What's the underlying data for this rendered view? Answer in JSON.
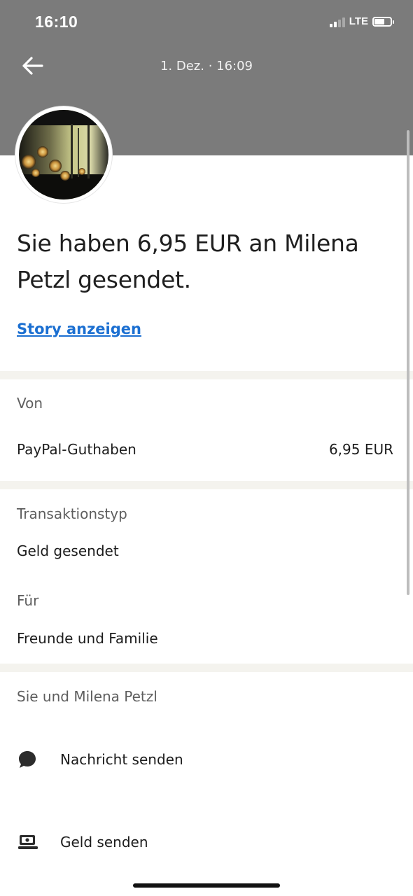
{
  "status_bar": {
    "time": "16:10",
    "network": "LTE"
  },
  "header": {
    "back_icon": "arrow-left-icon",
    "title": "1. Dez. · 16:09"
  },
  "summary": {
    "headline": "Sie haben 6,95 EUR an Milena Petzl gesendet.",
    "story_link": "Story anzeigen"
  },
  "source": {
    "label": "Von",
    "account": "PayPal-Guthaben",
    "amount": "6,95 EUR"
  },
  "details": {
    "type_label": "Transaktionstyp",
    "type_value": "Geld gesendet",
    "for_label": "Für",
    "for_value": "Freunde und Familie"
  },
  "contact": {
    "heading": "Sie und Milena Petzl",
    "actions": [
      {
        "icon": "chat-bubble-icon",
        "label": "Nachricht senden"
      },
      {
        "icon": "money-icon",
        "label": "Geld senden"
      }
    ]
  },
  "colors": {
    "header_bg": "#7b7b7b",
    "link": "#1b6fd1",
    "divider": "#f4f3ee"
  }
}
